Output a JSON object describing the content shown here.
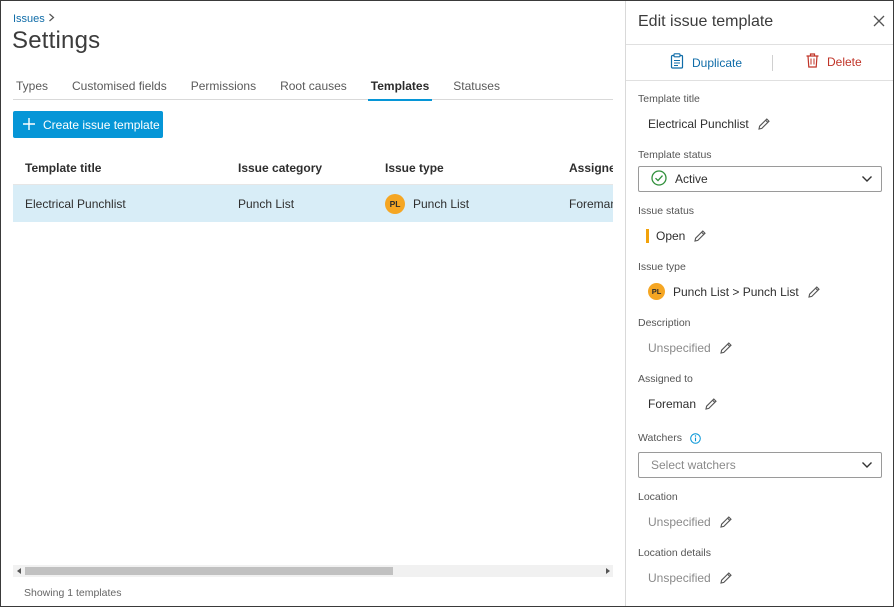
{
  "breadcrumb": {
    "label": "Issues",
    "chevron": ">"
  },
  "page_title": "Settings",
  "tabs": [
    {
      "label": "Types"
    },
    {
      "label": "Customised fields"
    },
    {
      "label": "Permissions"
    },
    {
      "label": "Root causes"
    },
    {
      "label": "Templates",
      "active": true
    },
    {
      "label": "Statuses"
    }
  ],
  "create_button": {
    "label": "Create issue template",
    "icon": "plus-icon"
  },
  "table": {
    "columns": [
      "Template title",
      "Issue category",
      "Issue type",
      "Assigned"
    ],
    "rows": [
      {
        "title": "Electrical Punchlist",
        "category": "Punch List",
        "type_badge": "PL",
        "type": "Punch List",
        "assigned": "Foreman",
        "selected": true
      }
    ]
  },
  "footer": {
    "count_text": "Showing 1 templates"
  },
  "panel": {
    "title": "Edit issue template",
    "duplicate_label": "Duplicate",
    "delete_label": "Delete",
    "fields": {
      "template_title": {
        "label": "Template title",
        "value": "Electrical Punchlist"
      },
      "template_status": {
        "label": "Template status",
        "value": "Active"
      },
      "issue_status": {
        "label": "Issue status",
        "value": "Open"
      },
      "issue_type": {
        "label": "Issue type",
        "badge": "PL",
        "value": "Punch List > Punch List"
      },
      "description": {
        "label": "Description",
        "value": "Unspecified"
      },
      "assigned_to": {
        "label": "Assigned to",
        "value": "Foreman"
      },
      "watchers": {
        "label": "Watchers",
        "placeholder": "Select watchers"
      },
      "location": {
        "label": "Location",
        "value": "Unspecified"
      },
      "location_details": {
        "label": "Location details",
        "value": "Unspecified"
      }
    }
  },
  "colors": {
    "accent": "#0696d7",
    "link": "#0f6ca8",
    "delete": "#c03428",
    "selected_row": "#d8edf7",
    "badge": "#f5a623",
    "status_open": "#f2a20a",
    "active_check": "#2f8f3a"
  }
}
